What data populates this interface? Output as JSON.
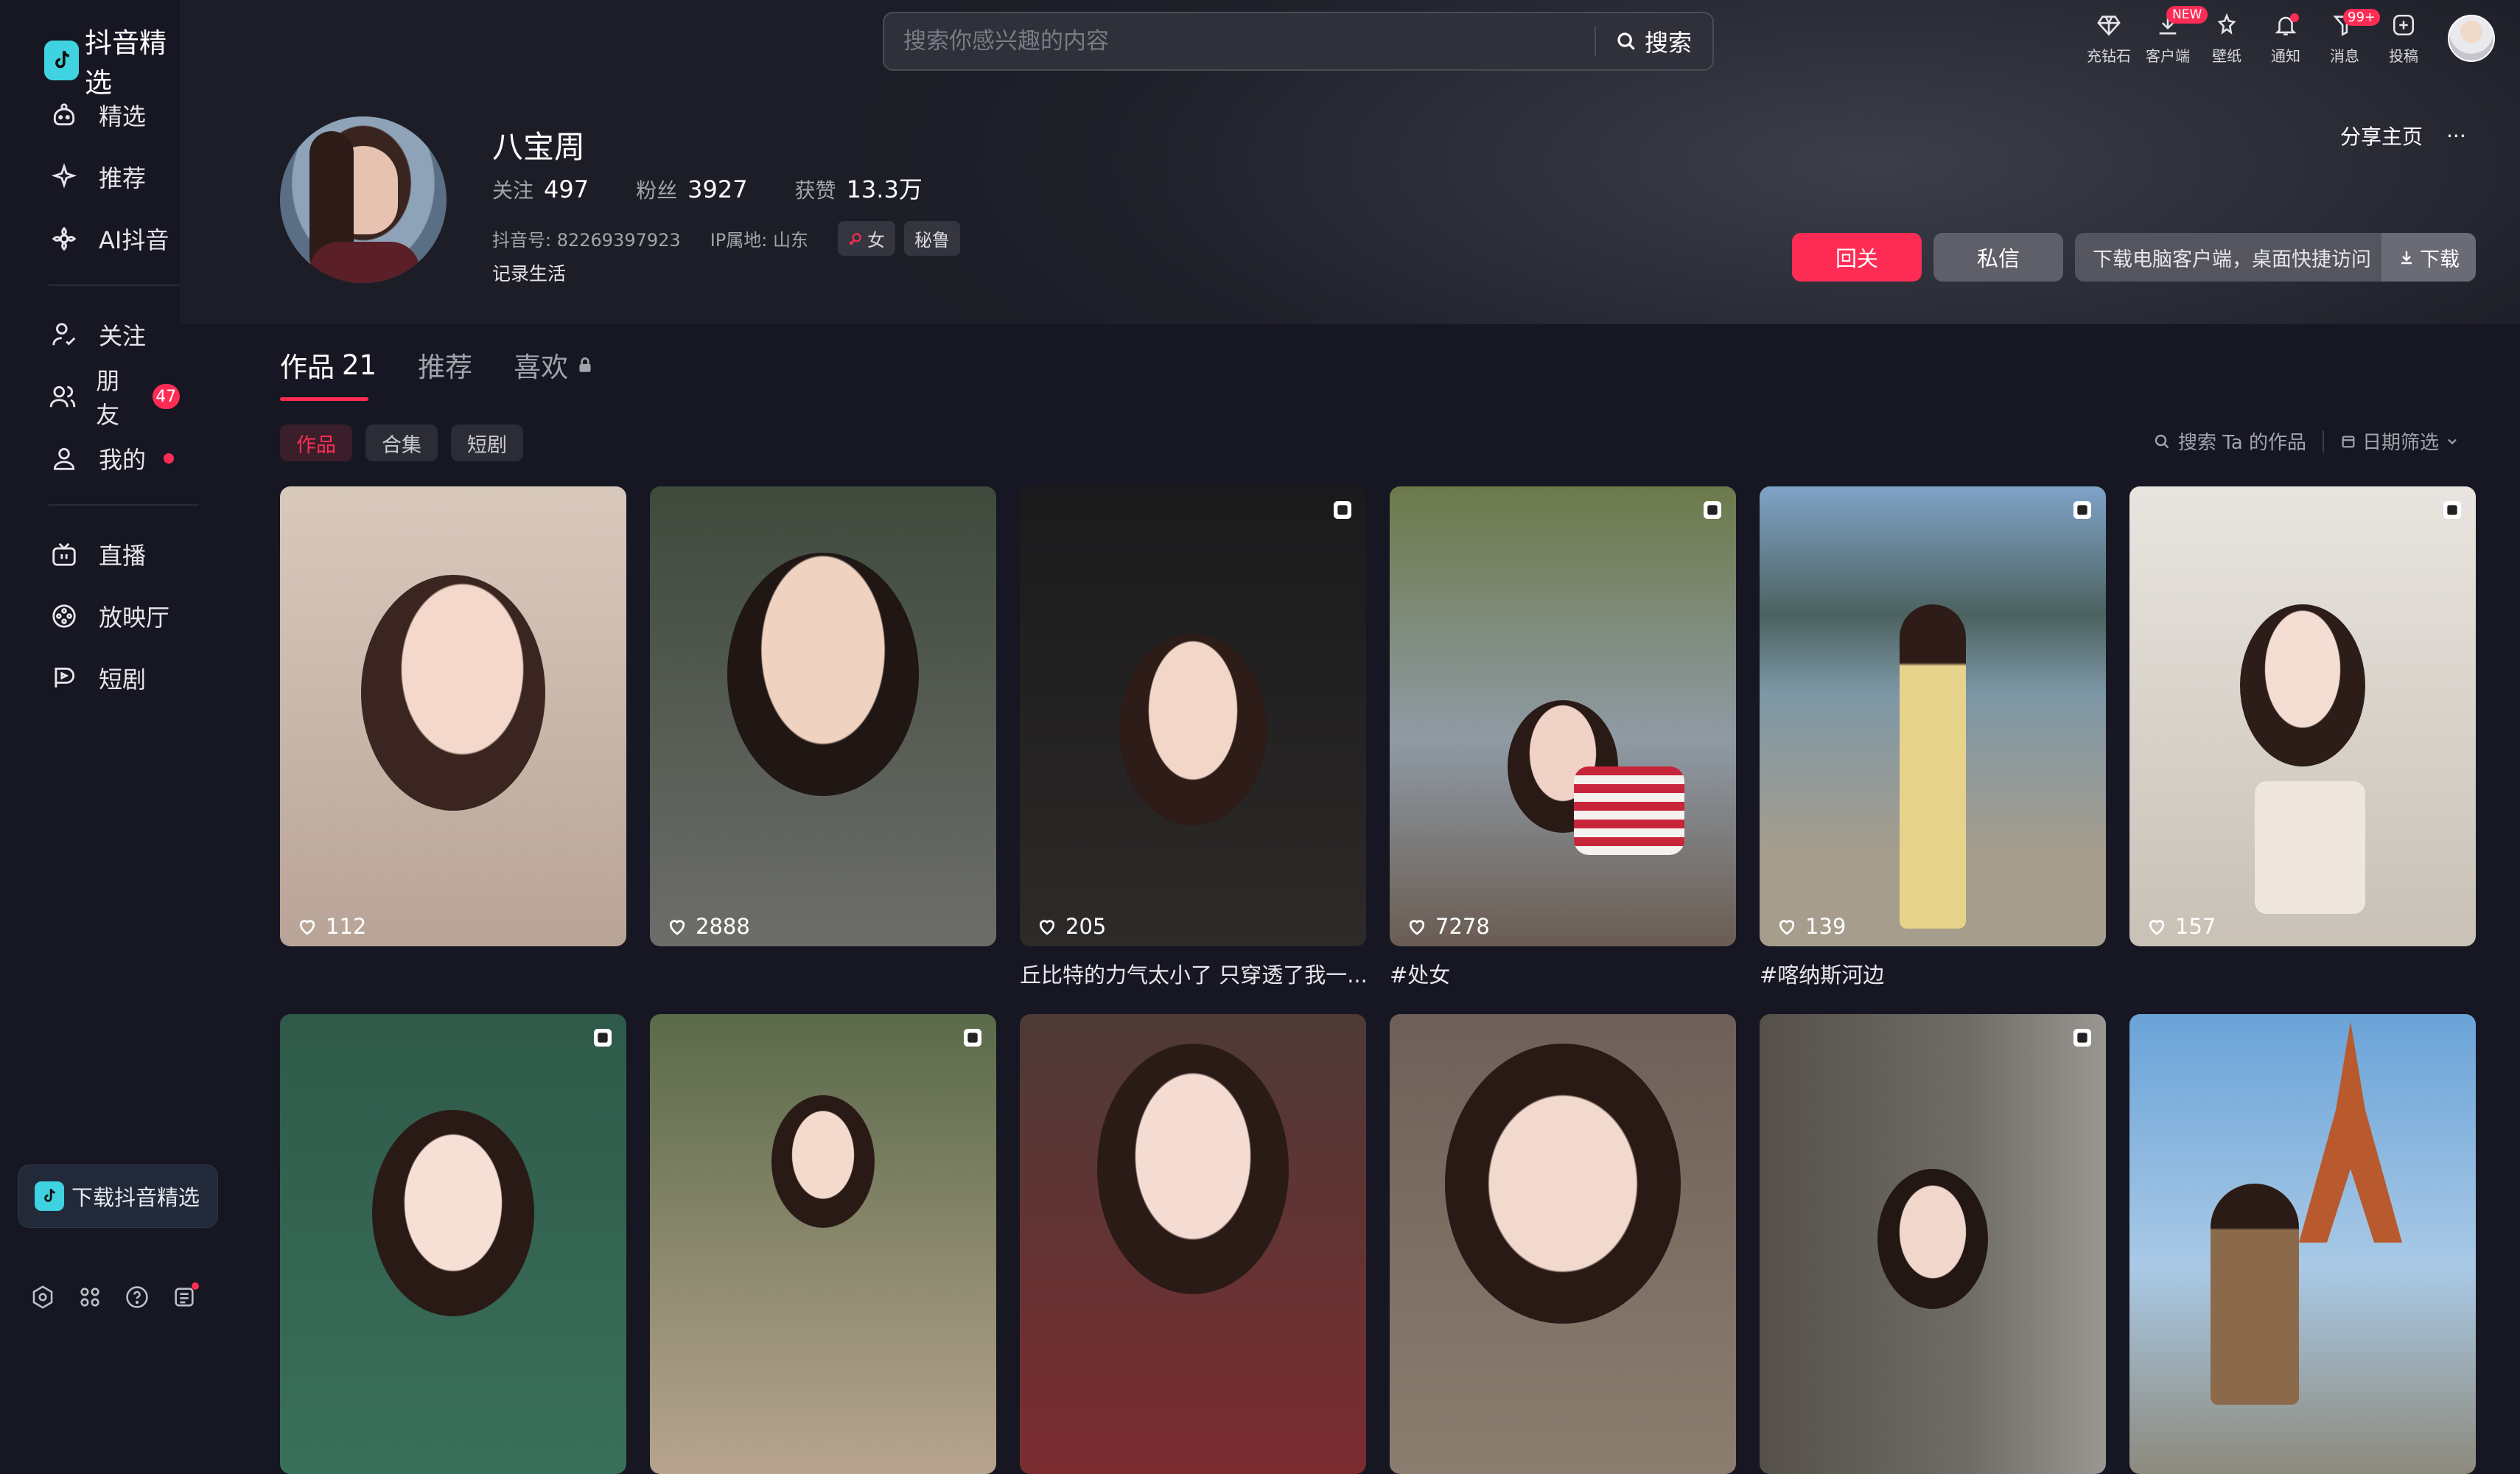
{
  "app": {
    "name": "抖音精选"
  },
  "sidebar": {
    "items": [
      {
        "label": "精选"
      },
      {
        "label": "推荐"
      },
      {
        "label": "AI抖音"
      },
      {
        "label": "关注"
      },
      {
        "label": "朋友",
        "badge": "47"
      },
      {
        "label": "我的"
      },
      {
        "label": "直播"
      },
      {
        "label": "放映厅"
      },
      {
        "label": "短剧"
      }
    ],
    "download_label": "下载抖音精选"
  },
  "search": {
    "placeholder": "搜索你感兴趣的内容",
    "button_label": "搜索"
  },
  "top_icons": [
    {
      "label": "充钻石"
    },
    {
      "label": "客户端",
      "badge": "NEW"
    },
    {
      "label": "壁纸"
    },
    {
      "label": "通知"
    },
    {
      "label": "消息",
      "badge": "99+"
    },
    {
      "label": "投稿"
    }
  ],
  "profile": {
    "name": "八宝周",
    "following_label": "关注",
    "following": "497",
    "followers_label": "粉丝",
    "followers": "3927",
    "likes_label": "获赞",
    "likes": "13.3万",
    "douyin_id": "抖音号: 82269397923",
    "ip": "IP属地: 山东",
    "gender_tag": "女",
    "location_tag": "秘鲁",
    "bio": "记录生活",
    "share_label": "分享主页",
    "more_label": "···",
    "follow_back_label": "回关",
    "message_label": "私信",
    "desktop_prompt": "下载电脑客户端，桌面快捷访问",
    "download_label": "下载"
  },
  "tabs": [
    {
      "label": "作品",
      "count": "21"
    },
    {
      "label": "推荐"
    },
    {
      "label": "喜欢"
    }
  ],
  "subtabs": [
    "作品",
    "合集",
    "短剧"
  ],
  "tools": {
    "search_works": "搜索 Ta 的作品",
    "date_filter": "日期筛选"
  },
  "works": [
    {
      "likes": "112",
      "caption": ""
    },
    {
      "likes": "2888",
      "caption": ""
    },
    {
      "likes": "205",
      "caption": "丘比特的力气太小了 只穿透了我一..."
    },
    {
      "likes": "7278",
      "caption": "#处女"
    },
    {
      "likes": "139",
      "caption": "#喀纳斯河边"
    },
    {
      "likes": "157",
      "caption": ""
    },
    {
      "likes": "",
      "caption": ""
    },
    {
      "likes": "",
      "caption": ""
    },
    {
      "likes": "",
      "caption": ""
    },
    {
      "likes": "",
      "caption": ""
    },
    {
      "likes": "",
      "caption": ""
    },
    {
      "likes": "",
      "caption": ""
    }
  ],
  "colors": {
    "accent": "#fe2c55",
    "bg": "#161722",
    "logo": "#3fd2e0"
  }
}
